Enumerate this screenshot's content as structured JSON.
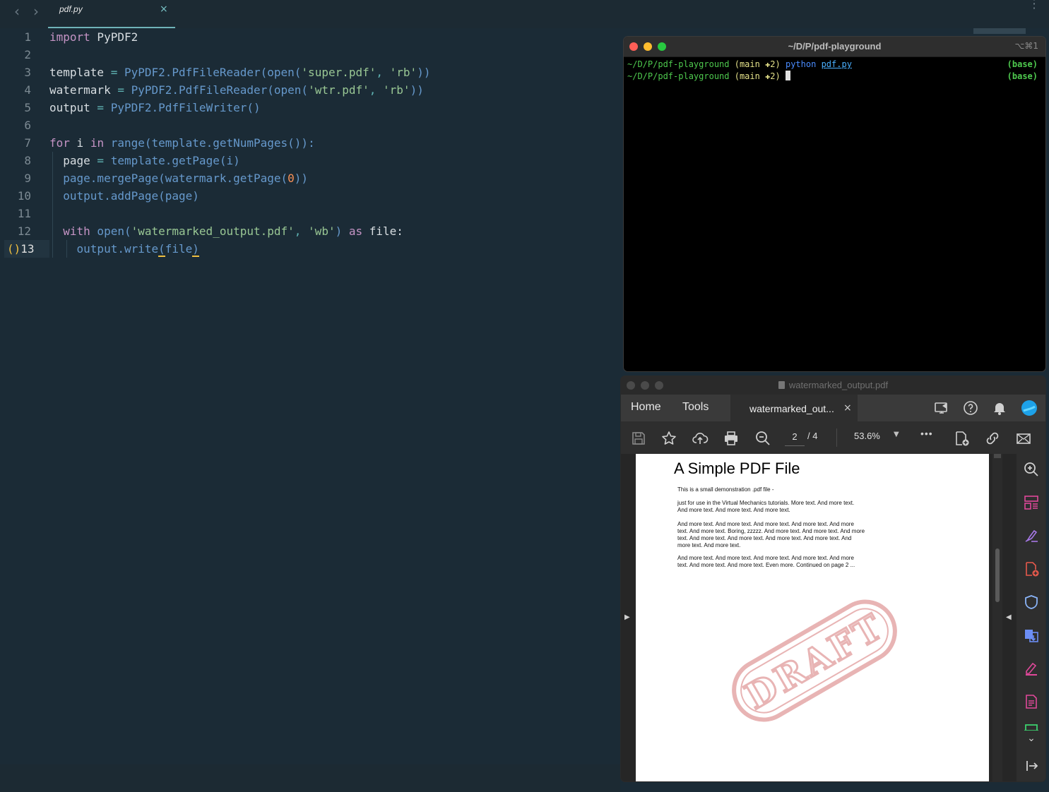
{
  "editor": {
    "tab": {
      "filename": "pdf.py",
      "close": "×"
    },
    "nav": {
      "back": "‹",
      "forward": "›"
    },
    "more": "⋮",
    "active_line_prefix": "()",
    "line_numbers": [
      "1",
      "2",
      "3",
      "4",
      "5",
      "6",
      "7",
      "8",
      "9",
      "10",
      "11",
      "12",
      "13"
    ],
    "code": {
      "l1": {
        "kw": "import",
        "rest": " PyPDF2"
      },
      "l3": {
        "var": "template",
        "eq": " = ",
        "call": "PyPDF2.PdfFileReader(open(",
        "s1": "'super.pdf'",
        "c": ", ",
        "s2": "'rb'",
        "end": "))"
      },
      "l4": {
        "var": "watermark",
        "eq": " = ",
        "call": "PyPDF2.PdfFileReader(open(",
        "s1": "'wtr.pdf'",
        "c": ", ",
        "s2": "'rb'",
        "end": "))"
      },
      "l5": {
        "var": "output",
        "eq": " = ",
        "call": "PyPDF2.PdfFileWriter()"
      },
      "l7": {
        "kw1": "for",
        "v": " i ",
        "kw2": "in",
        "call": " range(template.getNumPages()):"
      },
      "l8": {
        "var": "  page",
        "eq": " = ",
        "call": "template.getPage(i)"
      },
      "l9": {
        "call": "  page.mergePage(watermark.getPage(",
        "num": "0",
        "end": "))"
      },
      "l10": {
        "call": "  output.addPage(page)"
      },
      "l12": {
        "kw": "  with",
        "call": " open(",
        "s1": "'watermarked_output.pdf'",
        "c": ", ",
        "s2": "'wb'",
        "end": ") ",
        "kw2": "as",
        "rest": " file:"
      },
      "l13": {
        "call": "    output.write",
        "p1": "(",
        "arg": "file",
        "p2": ")"
      }
    }
  },
  "terminal": {
    "title": "~/D/P/pdf-playground",
    "shortcut": "⌥⌘1",
    "lines": [
      {
        "path": "~/D/P/pdf-playground",
        "branch": " (main ✚2) ",
        "cmd": "python",
        "arg": "pdf.py",
        "env": "(base)"
      },
      {
        "path": "~/D/P/pdf-playground",
        "branch": " (main ✚2) ",
        "env": "(base)"
      }
    ]
  },
  "pdf_viewer": {
    "window_title": "watermarked_output.pdf",
    "nav_tabs": [
      "Home",
      "Tools"
    ],
    "doc_tab": "watermarked_out...",
    "doc_tab_close": "×",
    "current_page": "2",
    "total_pages": "/ 4",
    "zoom": "53.6%",
    "more": "•••",
    "document": {
      "heading": "A Simple PDF File",
      "paragraphs": [
        "This is a small demonstration .pdf file -",
        "just for use in the Virtual Mechanics tutorials. More text. And more text. And more text. And more text. And more text.",
        "And more text. And more text. And more text. And more text. And more text. And more text. Boring, zzzzz. And more text. And more text. And more text. And more text. And more text. And more text. And more text. And more text. And more text.",
        "And more text. And more text. And more text. And more text. And more text. And more text. And more text. Even more. Continued on page 2 ..."
      ],
      "watermark": "DRAFT"
    },
    "colors": {
      "watermark": "#e8b4b4",
      "accent": "#1da1e8"
    }
  }
}
